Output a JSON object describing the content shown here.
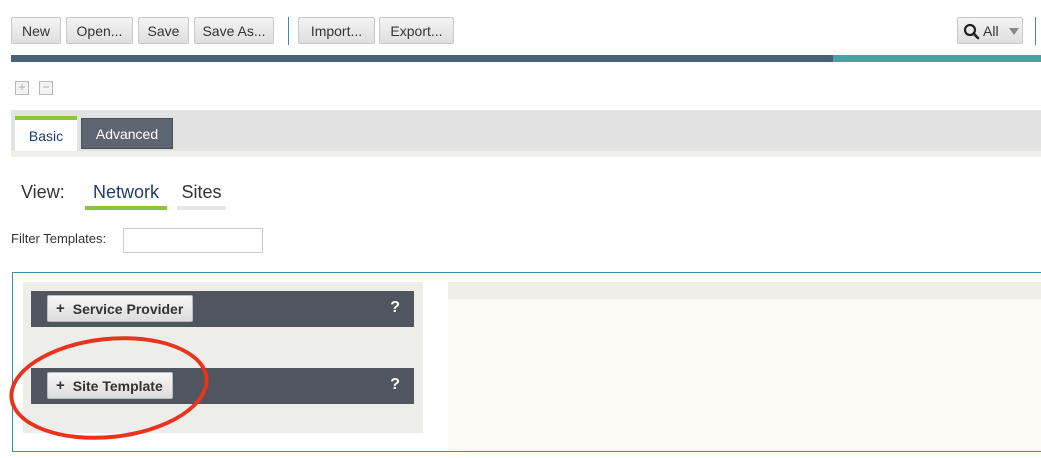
{
  "toolbar": {
    "new_label": "New",
    "open_label": "Open...",
    "save_label": "Save",
    "save_as_label": "Save As...",
    "import_label": "Import...",
    "export_label": "Export...",
    "search_scope": "All"
  },
  "expand": {
    "expand_symbol": "+",
    "collapse_symbol": "−"
  },
  "tabs": {
    "basic": "Basic",
    "advanced": "Advanced",
    "active": "Basic"
  },
  "view": {
    "label": "View:",
    "network": "Network",
    "sites": "Sites",
    "selected": "Network"
  },
  "filter": {
    "label": "Filter Templates:",
    "value": "",
    "placeholder": ""
  },
  "templates": [
    {
      "label": "Service Provider",
      "help": "?"
    },
    {
      "label": "Site Template",
      "help": "?"
    }
  ],
  "colors": {
    "accent_green": "#8cc43e",
    "header_bar_dark": "#4a6079",
    "header_bar_teal": "#4e9ea2",
    "row_dark": "#4f5660",
    "highlight_red": "#e8341c",
    "panel_border": "#3a8fa5"
  },
  "icons": {
    "search": "search-icon",
    "dropdown": "chevron-down-icon",
    "expand": "expand-all-icon",
    "collapse": "collapse-all-icon",
    "add": "plus-icon",
    "help": "help-icon"
  }
}
